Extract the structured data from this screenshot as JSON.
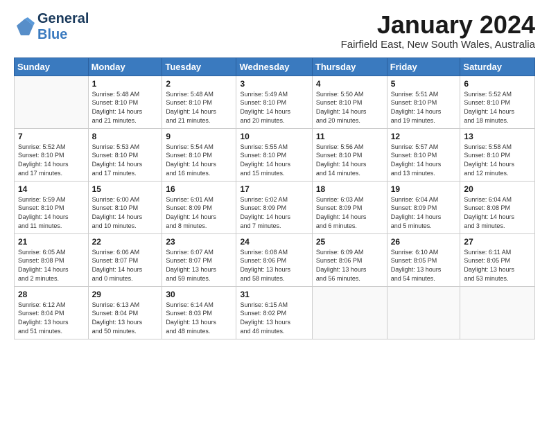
{
  "logo": {
    "line1": "General",
    "line2": "Blue"
  },
  "header": {
    "month": "January 2024",
    "location": "Fairfield East, New South Wales, Australia"
  },
  "weekdays": [
    "Sunday",
    "Monday",
    "Tuesday",
    "Wednesday",
    "Thursday",
    "Friday",
    "Saturday"
  ],
  "weeks": [
    [
      {
        "day": "",
        "info": ""
      },
      {
        "day": "1",
        "info": "Sunrise: 5:48 AM\nSunset: 8:10 PM\nDaylight: 14 hours\nand 21 minutes."
      },
      {
        "day": "2",
        "info": "Sunrise: 5:48 AM\nSunset: 8:10 PM\nDaylight: 14 hours\nand 21 minutes."
      },
      {
        "day": "3",
        "info": "Sunrise: 5:49 AM\nSunset: 8:10 PM\nDaylight: 14 hours\nand 20 minutes."
      },
      {
        "day": "4",
        "info": "Sunrise: 5:50 AM\nSunset: 8:10 PM\nDaylight: 14 hours\nand 20 minutes."
      },
      {
        "day": "5",
        "info": "Sunrise: 5:51 AM\nSunset: 8:10 PM\nDaylight: 14 hours\nand 19 minutes."
      },
      {
        "day": "6",
        "info": "Sunrise: 5:52 AM\nSunset: 8:10 PM\nDaylight: 14 hours\nand 18 minutes."
      }
    ],
    [
      {
        "day": "7",
        "info": "Sunrise: 5:52 AM\nSunset: 8:10 PM\nDaylight: 14 hours\nand 17 minutes."
      },
      {
        "day": "8",
        "info": "Sunrise: 5:53 AM\nSunset: 8:10 PM\nDaylight: 14 hours\nand 17 minutes."
      },
      {
        "day": "9",
        "info": "Sunrise: 5:54 AM\nSunset: 8:10 PM\nDaylight: 14 hours\nand 16 minutes."
      },
      {
        "day": "10",
        "info": "Sunrise: 5:55 AM\nSunset: 8:10 PM\nDaylight: 14 hours\nand 15 minutes."
      },
      {
        "day": "11",
        "info": "Sunrise: 5:56 AM\nSunset: 8:10 PM\nDaylight: 14 hours\nand 14 minutes."
      },
      {
        "day": "12",
        "info": "Sunrise: 5:57 AM\nSunset: 8:10 PM\nDaylight: 14 hours\nand 13 minutes."
      },
      {
        "day": "13",
        "info": "Sunrise: 5:58 AM\nSunset: 8:10 PM\nDaylight: 14 hours\nand 12 minutes."
      }
    ],
    [
      {
        "day": "14",
        "info": "Sunrise: 5:59 AM\nSunset: 8:10 PM\nDaylight: 14 hours\nand 11 minutes."
      },
      {
        "day": "15",
        "info": "Sunrise: 6:00 AM\nSunset: 8:10 PM\nDaylight: 14 hours\nand 10 minutes."
      },
      {
        "day": "16",
        "info": "Sunrise: 6:01 AM\nSunset: 8:09 PM\nDaylight: 14 hours\nand 8 minutes."
      },
      {
        "day": "17",
        "info": "Sunrise: 6:02 AM\nSunset: 8:09 PM\nDaylight: 14 hours\nand 7 minutes."
      },
      {
        "day": "18",
        "info": "Sunrise: 6:03 AM\nSunset: 8:09 PM\nDaylight: 14 hours\nand 6 minutes."
      },
      {
        "day": "19",
        "info": "Sunrise: 6:04 AM\nSunset: 8:09 PM\nDaylight: 14 hours\nand 5 minutes."
      },
      {
        "day": "20",
        "info": "Sunrise: 6:04 AM\nSunset: 8:08 PM\nDaylight: 14 hours\nand 3 minutes."
      }
    ],
    [
      {
        "day": "21",
        "info": "Sunrise: 6:05 AM\nSunset: 8:08 PM\nDaylight: 14 hours\nand 2 minutes."
      },
      {
        "day": "22",
        "info": "Sunrise: 6:06 AM\nSunset: 8:07 PM\nDaylight: 14 hours\nand 0 minutes."
      },
      {
        "day": "23",
        "info": "Sunrise: 6:07 AM\nSunset: 8:07 PM\nDaylight: 13 hours\nand 59 minutes."
      },
      {
        "day": "24",
        "info": "Sunrise: 6:08 AM\nSunset: 8:06 PM\nDaylight: 13 hours\nand 58 minutes."
      },
      {
        "day": "25",
        "info": "Sunrise: 6:09 AM\nSunset: 8:06 PM\nDaylight: 13 hours\nand 56 minutes."
      },
      {
        "day": "26",
        "info": "Sunrise: 6:10 AM\nSunset: 8:05 PM\nDaylight: 13 hours\nand 54 minutes."
      },
      {
        "day": "27",
        "info": "Sunrise: 6:11 AM\nSunset: 8:05 PM\nDaylight: 13 hours\nand 53 minutes."
      }
    ],
    [
      {
        "day": "28",
        "info": "Sunrise: 6:12 AM\nSunset: 8:04 PM\nDaylight: 13 hours\nand 51 minutes."
      },
      {
        "day": "29",
        "info": "Sunrise: 6:13 AM\nSunset: 8:04 PM\nDaylight: 13 hours\nand 50 minutes."
      },
      {
        "day": "30",
        "info": "Sunrise: 6:14 AM\nSunset: 8:03 PM\nDaylight: 13 hours\nand 48 minutes."
      },
      {
        "day": "31",
        "info": "Sunrise: 6:15 AM\nSunset: 8:02 PM\nDaylight: 13 hours\nand 46 minutes."
      },
      {
        "day": "",
        "info": ""
      },
      {
        "day": "",
        "info": ""
      },
      {
        "day": "",
        "info": ""
      }
    ]
  ]
}
